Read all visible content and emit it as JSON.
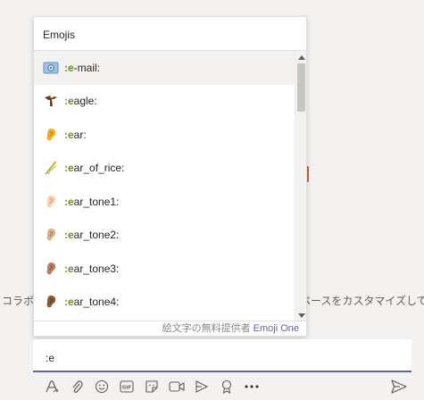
{
  "background": {
    "left_text": "コラボ",
    "right_text": "ペースをカスタマイズしてみ"
  },
  "emoji_picker": {
    "title": "Emojis",
    "highlight": ":e",
    "items": [
      {
        "icon": "email-icon",
        "rest": "-mail:",
        "selected": true
      },
      {
        "icon": "eagle-icon",
        "rest": "agle:"
      },
      {
        "icon": "ear-icon",
        "rest": "ar:"
      },
      {
        "icon": "ear-of-rice-icon",
        "rest": "ar_of_rice:"
      },
      {
        "icon": "ear-tone1-icon",
        "rest": "ar_tone1:"
      },
      {
        "icon": "ear-tone2-icon",
        "rest": "ar_tone2:"
      },
      {
        "icon": "ear-tone3-icon",
        "rest": "ar_tone3:"
      },
      {
        "icon": "ear-tone4-icon",
        "rest": "ar_tone4:"
      }
    ],
    "footer_prefix": "絵文字の無料提供者 ",
    "footer_brand": "Emoji One"
  },
  "compose": {
    "text": ":e"
  },
  "colors": {
    "accent": "#6264a7",
    "match": "#6b8e23"
  }
}
